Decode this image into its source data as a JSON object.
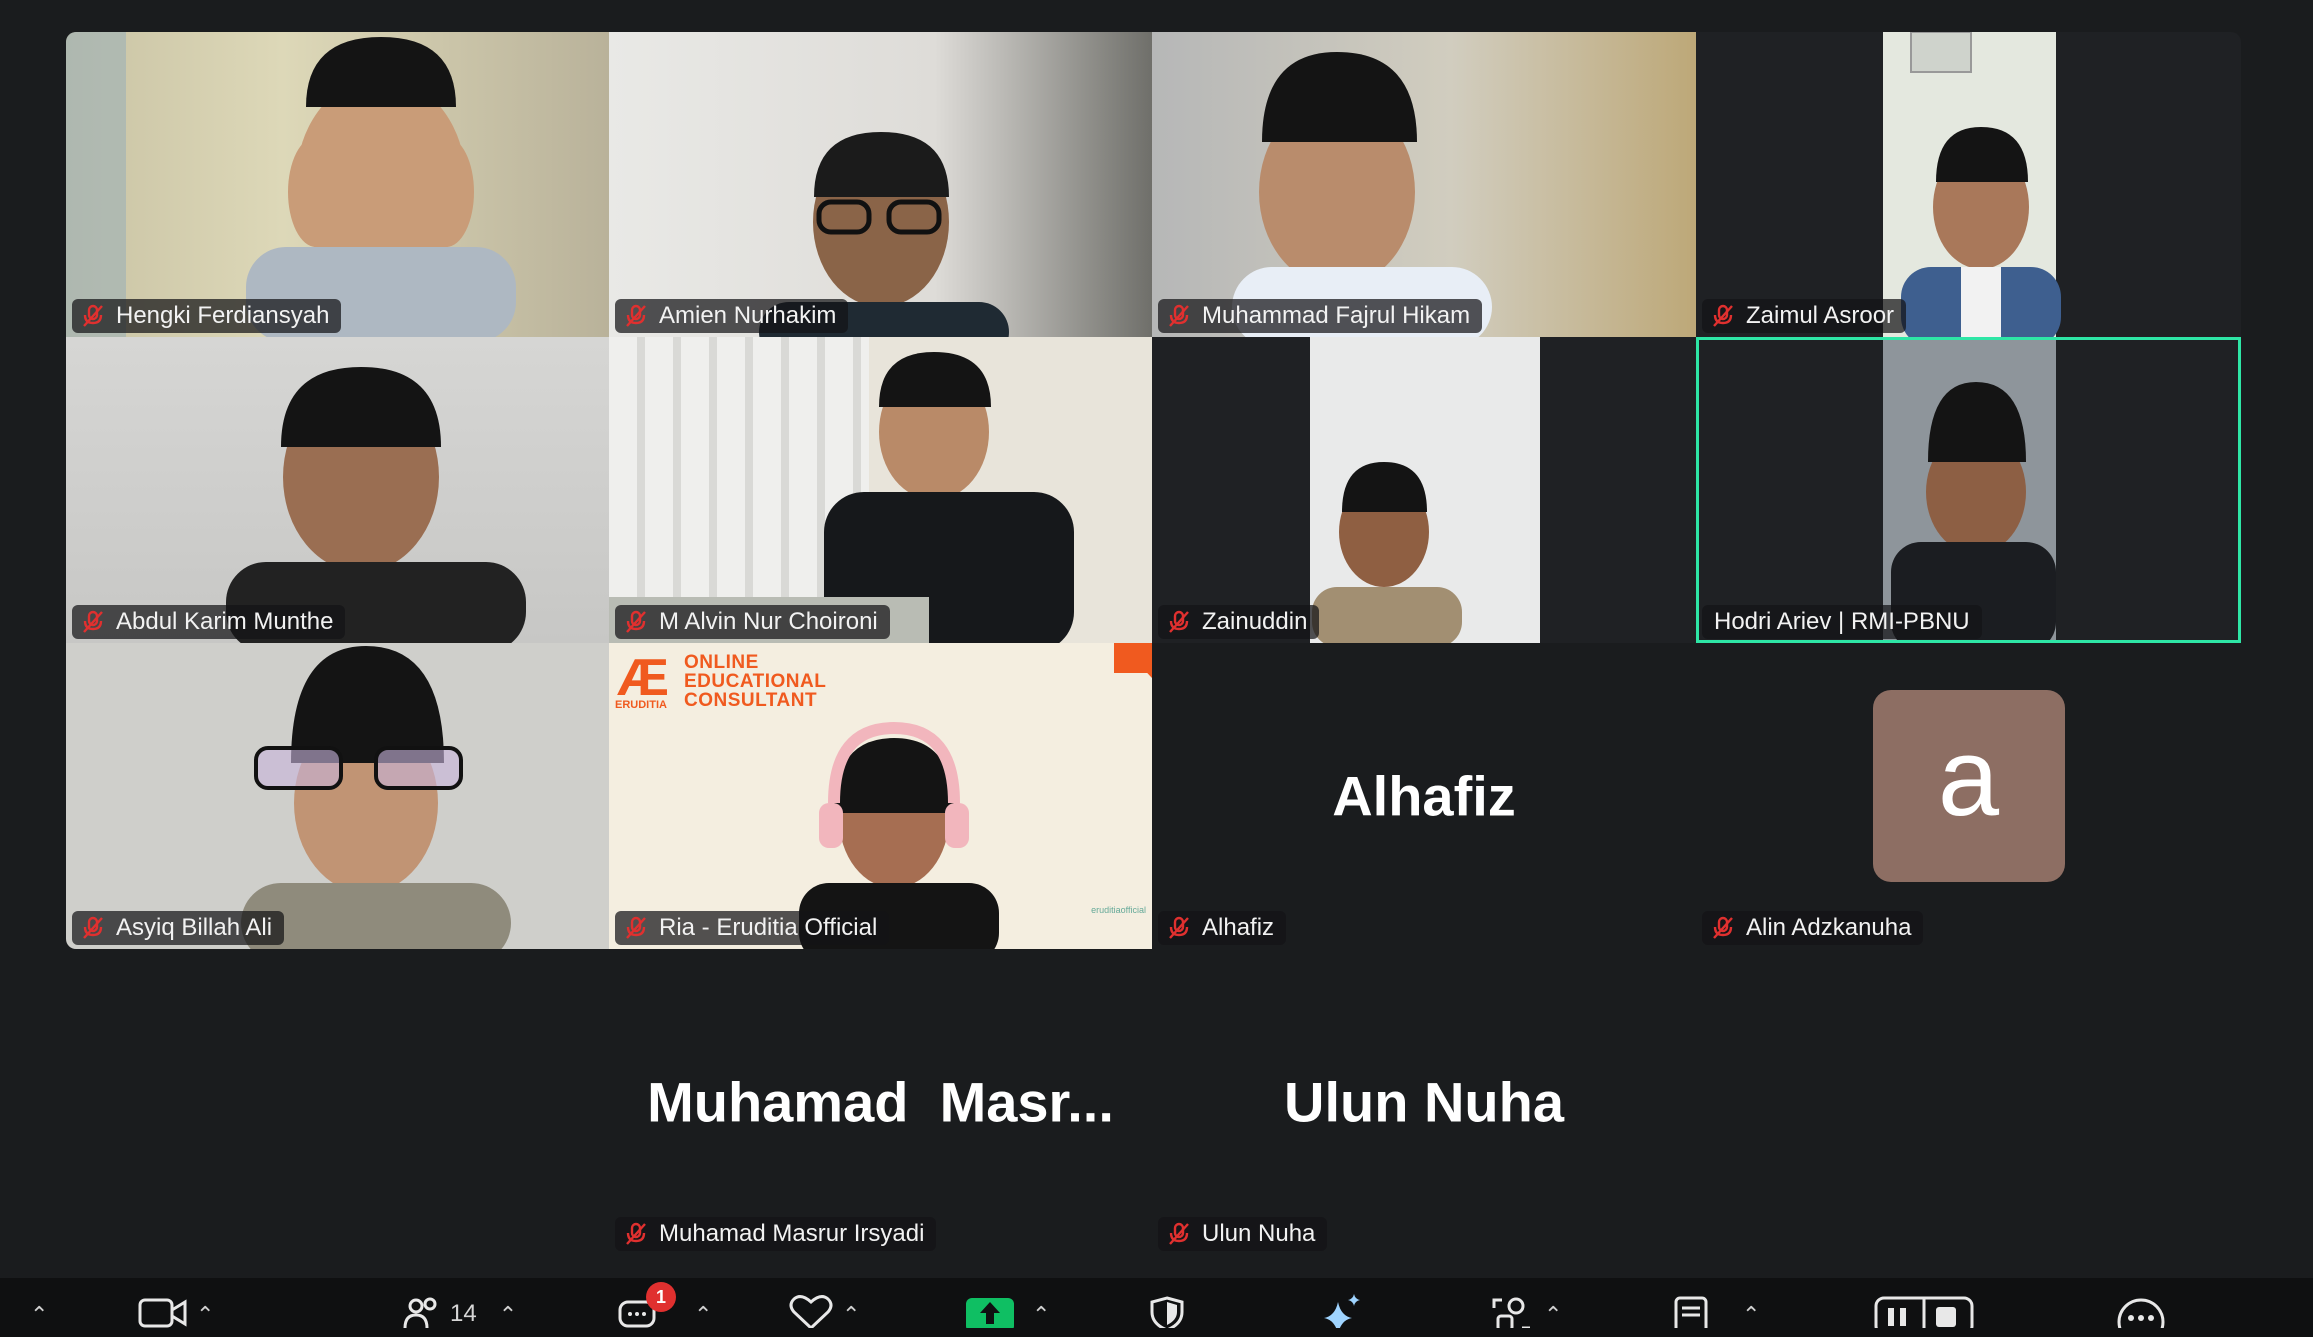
{
  "meeting": {
    "participants": [
      {
        "name": "Hengki Ferdiansyah",
        "muted": true
      },
      {
        "name": "Amien Nurhakim",
        "muted": true
      },
      {
        "name": "Muhammad Fajrul Hikam",
        "muted": true
      },
      {
        "name": "Zaimul Asroor",
        "muted": true
      },
      {
        "name": "Abdul Karim Munthe",
        "muted": true
      },
      {
        "name": "M Alvin Nur Choironi",
        "muted": true
      },
      {
        "name": "Zainuddin",
        "muted": true
      },
      {
        "name": "Hodri Ariev | RMI-PBNU",
        "muted": false,
        "active_speaker": true
      },
      {
        "name": "Asyiq Billah Ali",
        "muted": true
      },
      {
        "name": "Ria - Eruditia Official",
        "muted": true
      },
      {
        "name": "Alhafiz",
        "muted": true,
        "display_name": "Alhafiz"
      },
      {
        "name": "Alin Adzkanuha",
        "muted": true,
        "avatar_letter": "a"
      },
      {
        "name": "Muhamad Masrur Irsyadi",
        "muted": true,
        "display_name": "Muhamad  Masr..."
      },
      {
        "name": "Ulun Nuha",
        "muted": true,
        "display_name": "Ulun Nuha"
      }
    ],
    "eruditia_banner": {
      "line1": "ONLINE",
      "line2": "EDUCATIONAL",
      "line3": "CONSULTANT",
      "logo_text": "ERUDITIA",
      "watermark": "eruditiaofficial"
    }
  },
  "toolbar": {
    "participants_count": "14",
    "chat_badge": "1",
    "icons": [
      "mic-icon",
      "video-icon",
      "participants-icon",
      "chat-icon",
      "react-icon",
      "share-screen-icon",
      "security-icon",
      "ai-companion-icon",
      "apps-icon",
      "notes-icon",
      "pause-record-icon",
      "more-icon"
    ]
  },
  "colors": {
    "background": "#1a1c1e",
    "active_speaker_border": "#2ee6a6",
    "muted_mic": "#e0302f",
    "share_green": "#0fbf63",
    "avatar_bg": "#8d6e63"
  }
}
